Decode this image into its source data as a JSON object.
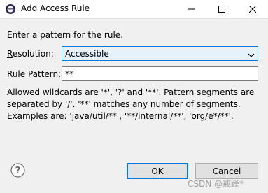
{
  "window": {
    "title": "Add Access Rule",
    "minimize_icon": "minimize-icon",
    "maximize_icon": "maximize-icon",
    "close_icon": "close-icon"
  },
  "dialog": {
    "intro": "Enter a pattern for the rule.",
    "resolution_label_mnemonic": "R",
    "resolution_label_rest": "esolution:",
    "resolution_value": "Accessible",
    "rule_pattern_label_mnemonic": "R",
    "rule_pattern_label_rest": "ule Pattern:",
    "rule_pattern_value": "**",
    "help_lines": [
      "Allowed wildcards are '*', '?' and '**'. Pattern segments are",
      "separated by '/'. '**' matches any number of segments.",
      "Examples are: 'java/util/**', '**/internal/**', 'org/e*/**'."
    ]
  },
  "buttons": {
    "ok": "OK",
    "cancel": "Cancel",
    "help_icon": "help-icon"
  },
  "watermark": "CSDN @戒躁*",
  "colors": {
    "accent": "#0078d7",
    "window_bg": "#f0f0f0",
    "combo_bg": "#e5f1fb",
    "button_bg": "#e1e1e1"
  }
}
